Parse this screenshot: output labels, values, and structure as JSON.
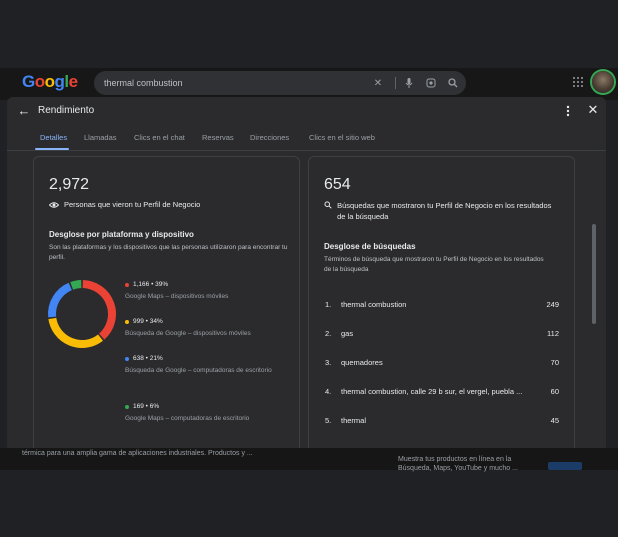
{
  "google": {
    "logo_letters": [
      "G",
      "o",
      "o",
      "g",
      "l",
      "e"
    ],
    "logo_colors": [
      "#4285f4",
      "#ea4335",
      "#fbbc05",
      "#4285f4",
      "#34a853",
      "#ea4335"
    ],
    "search_query": "thermal combustion"
  },
  "modal": {
    "title": "Rendimiento",
    "tabs": [
      "Detalles",
      "Llamadas",
      "Clics en el chat",
      "Reservas",
      "Direcciones",
      "Clics en el sitio web"
    ],
    "active_tab": "Detalles"
  },
  "profile_views": {
    "total": "2,972",
    "caption": "Personas que vieron tu Perfil de Negocio",
    "breakdown_title": "Desglose por plataforma y dispositivo",
    "breakdown_desc": "Son las plataformas y los dispositivos que las personas utilizaron para encontrar tu perfil.",
    "segments": [
      {
        "value": "1,166 • 39%",
        "label": "Google Maps – dispositivos móviles",
        "color": "#ea4335",
        "share": 39
      },
      {
        "value": "999 • 34%",
        "label": "Búsqueda de Google – dispositivos móviles",
        "color": "#fbbc05",
        "share": 34
      },
      {
        "value": "638 • 21%",
        "label": "Búsqueda de Google – computadoras de escritorio",
        "color": "#4285f4",
        "share": 21
      },
      {
        "value": "169 • 6%",
        "label": "Google Maps – computadoras de escritorio",
        "color": "#34a853",
        "share": 6
      }
    ]
  },
  "searches": {
    "total": "654",
    "caption": "Búsquedas que mostraron tu Perfil de Negocio en los resultados de la búsqueda",
    "breakdown_title": "Desglose de búsquedas",
    "breakdown_desc": "Términos de búsqueda que mostraron tu Perfil de Negocio en los resultados de la búsqueda",
    "rows": [
      {
        "rank": "1.",
        "term": "thermal combustion",
        "count": "249"
      },
      {
        "rank": "2.",
        "term": "gas",
        "count": "112"
      },
      {
        "rank": "3.",
        "term": "quemadores",
        "count": "70"
      },
      {
        "rank": "4.",
        "term": "thermal combustion, calle 29 b sur, el vergel, puebla ...",
        "count": "60"
      },
      {
        "rank": "5.",
        "term": "thermal",
        "count": "45"
      }
    ]
  },
  "background": {
    "left_snippet": "térmica para una amplia gama de aplicaciones industriales. Productos y ...",
    "right_snippet": "Muestra tus productos en línea en la Búsqueda, Maps, YouTube y mucho ..."
  }
}
